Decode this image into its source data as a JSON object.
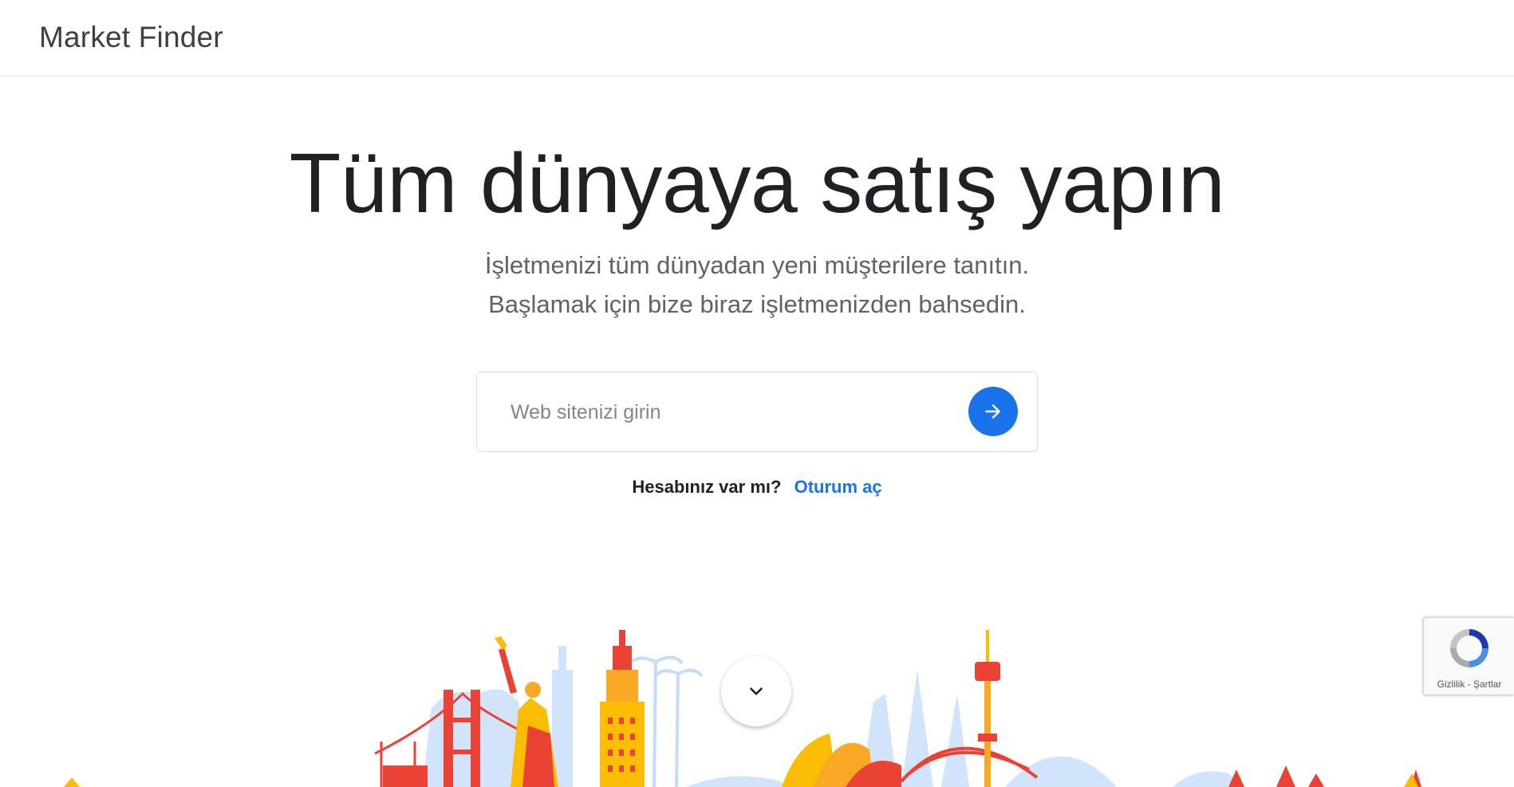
{
  "header": {
    "brand": "Market Finder"
  },
  "hero": {
    "title": "Tüm dünyaya satış yapın",
    "subtitle_line1": "İşletmenizi tüm dünyadan yeni müşterilere tanıtın.",
    "subtitle_line2": "Başlamak için bize biraz işletmenizden bahsedin."
  },
  "search": {
    "placeholder": "Web sitenizi girin",
    "value": "",
    "submit_icon": "arrow-right-icon"
  },
  "signin": {
    "question": "Hesabınız var mı?",
    "link_label": "Oturum aç"
  },
  "scroll": {
    "icon": "chevron-down-icon"
  },
  "recaptcha": {
    "privacy": "Gizlilik",
    "separator": " - ",
    "terms": "Şartlar"
  },
  "colors": {
    "accent": "#1a73e8",
    "text_primary": "#202124",
    "text_secondary": "#5f6368",
    "skyline_red": "#ea4335",
    "skyline_yellow": "#fbbc04",
    "skyline_orange": "#f9a825",
    "skyline_light_blue": "#d2e3fc"
  }
}
